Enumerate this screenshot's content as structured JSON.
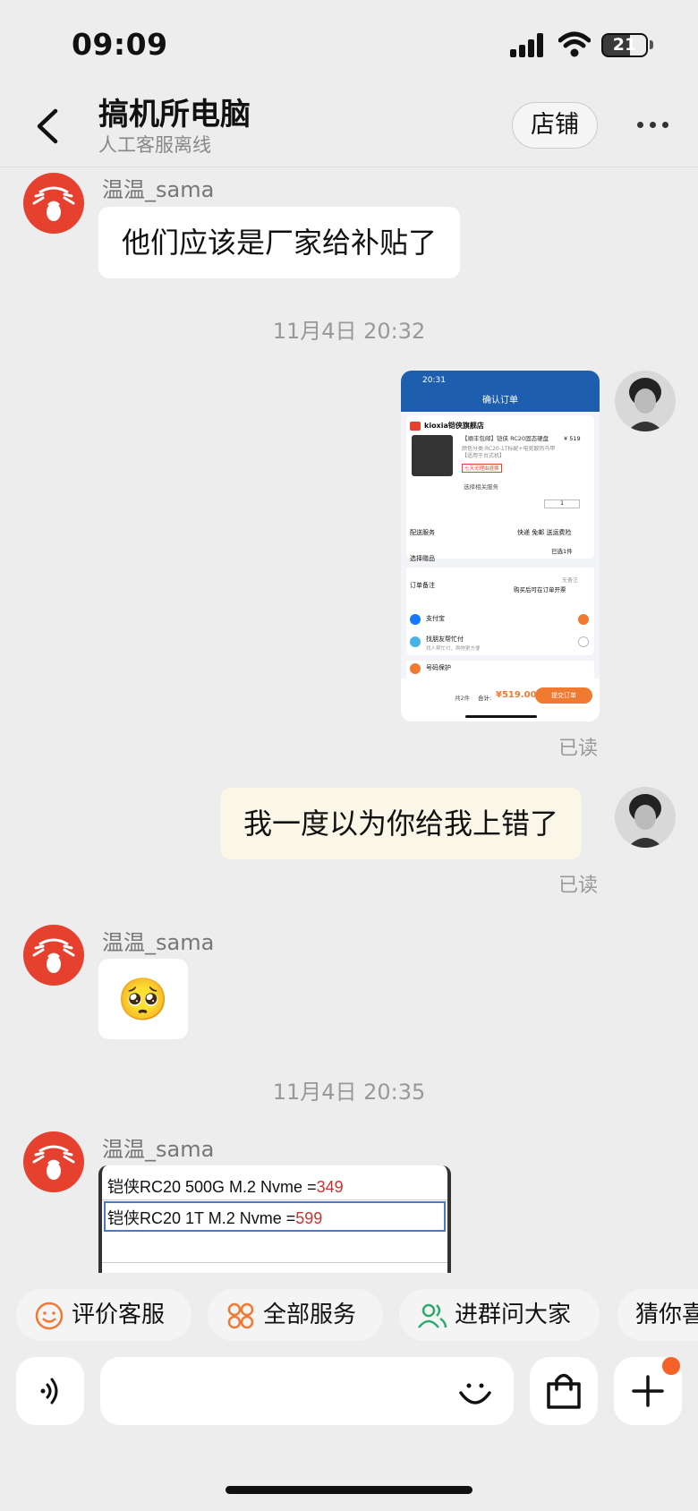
{
  "status": {
    "time": "09:09",
    "battery": "21"
  },
  "header": {
    "title": "搞机所电脑",
    "subtitle": "人工客服离线",
    "store_button": "店铺"
  },
  "messages": {
    "m1": {
      "sender": "温温_sama",
      "text": "他们应该是厂家给补贴了"
    },
    "ts1": "11月4日 20:32",
    "m2": {
      "read": "已读",
      "screenshot": {
        "time": "20:31",
        "title": "确认订单",
        "store": "kioxia铠侠旗舰店",
        "product": "【顺丰包邮】铠侠 RC20固态硬盘",
        "product_spec": "颜色分类:RC20-1T标配+电竞散热马甲【适用于台式机】",
        "price": "¥ 519",
        "tag": "七天无理由退换",
        "services": "选择相关服务",
        "qty": "1",
        "delivery_label": "配送服务",
        "delivery_value": "快递 免邮 送运费险",
        "gift_label": "选择赠品",
        "gift_value": "已选1件",
        "note_label": "订单备注",
        "note_value1": "无备注",
        "note_value2": "购买后可在订单开票",
        "pay1": "支付宝",
        "pay2": "找朋友帮忙付",
        "pay2_sub": "找人帮忙付，购物更方便",
        "pay3": "号码保护",
        "total_count": "共2件",
        "total_label": "合计:",
        "total": "¥519.00",
        "submit": "提交订单"
      }
    },
    "m3": {
      "text": "我一度以为你给我上错了",
      "read": "已读"
    },
    "m4": {
      "sender": "温温_sama",
      "emoji": "🥺"
    },
    "ts2": "11月4日 20:35",
    "m5": {
      "sender": "温温_sama",
      "rows": [
        {
          "label": "铠侠RC20 500G M.2 Nvme =",
          "price": "349"
        },
        {
          "label": "铠侠RC20 1T M.2 Nvme =",
          "price": "599"
        }
      ]
    }
  },
  "quick_actions": [
    "评价客服",
    "全部服务",
    "进群问大家",
    "猜你喜"
  ],
  "colors": {
    "accent": "#e6402e",
    "chip_orange": "#f07a32",
    "chip_green": "#2eaa6e"
  }
}
